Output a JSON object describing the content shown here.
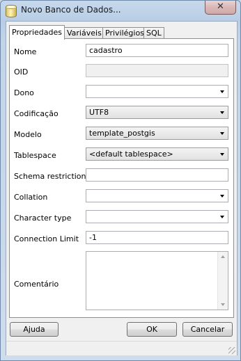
{
  "window": {
    "title": "Novo Banco de Dados...",
    "close_label": "✕"
  },
  "tabs": [
    {
      "label": "Propriedades",
      "active": true
    },
    {
      "label": "Variáveis",
      "active": false
    },
    {
      "label": "Privilégios",
      "active": false
    },
    {
      "label": "SQL",
      "active": false
    }
  ],
  "form": {
    "nome": {
      "label": "Nome",
      "value": "cadastro"
    },
    "oid": {
      "label": "OID",
      "value": ""
    },
    "dono": {
      "label": "Dono",
      "value": ""
    },
    "codificacao": {
      "label": "Codificação",
      "value": "UTF8"
    },
    "modelo": {
      "label": "Modelo",
      "value": "template_postgis"
    },
    "tablespace": {
      "label": "Tablespace",
      "value": "<default tablespace>"
    },
    "schema_restriction": {
      "label": "Schema restriction",
      "value": ""
    },
    "collation": {
      "label": "Collation",
      "value": ""
    },
    "character_type": {
      "label": "Character type",
      "value": ""
    },
    "connection_limit": {
      "label": "Connection Limit",
      "value": "-1"
    },
    "comentario": {
      "label": "Comentário",
      "value": ""
    }
  },
  "buttons": {
    "help": "Ajuda",
    "ok": "OK",
    "cancel": "Cancelar"
  },
  "icons": {
    "app": "database-icon",
    "dropdown": "chevron-down-icon"
  }
}
